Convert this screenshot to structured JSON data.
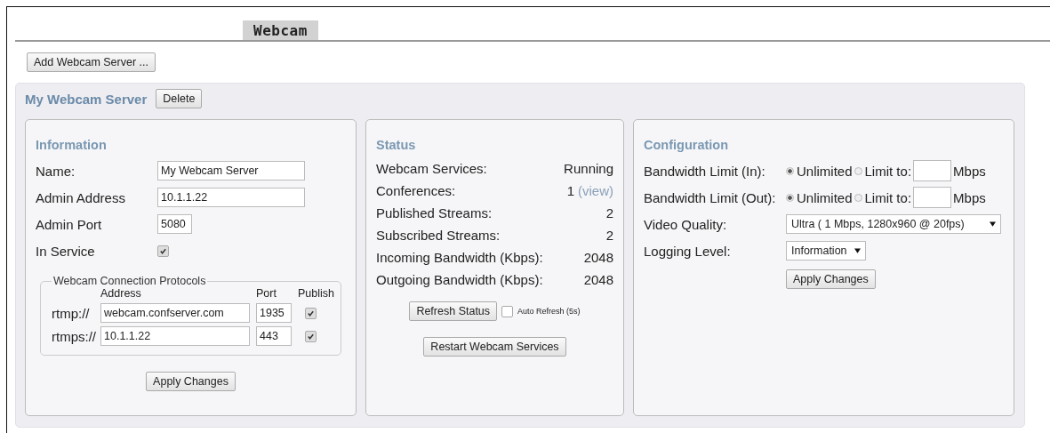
{
  "tabs": [
    {
      "label": "Webcam",
      "selected": true
    }
  ],
  "add_button": "Add Webcam Server ...",
  "server": {
    "name": "My Webcam Server",
    "delete_button": "Delete",
    "information": {
      "title": "Information",
      "fields": [
        {
          "kind": "text",
          "label": "Name:",
          "value": "My Webcam Server"
        },
        {
          "kind": "text",
          "label": "Admin Address",
          "value": "10.1.1.22"
        },
        {
          "kind": "short",
          "label": "Admin Port",
          "value": "5080"
        },
        {
          "kind": "checkbox",
          "label": "In Service",
          "checked": true
        }
      ],
      "protocols": {
        "legend": "Webcam Connection Protocols",
        "columns": [
          "Address",
          "Port",
          "Publish"
        ],
        "rows": [
          {
            "scheme": "rtmp://",
            "address": "webcam.confserver.com",
            "port": "1935",
            "publish": true
          },
          {
            "scheme": "rtmps://",
            "address": "10.1.1.22",
            "port": "443",
            "publish": true
          }
        ]
      },
      "apply_button": "Apply Changes"
    },
    "status": {
      "title": "Status",
      "rows": [
        {
          "label": "Webcam Services:",
          "value": "Running"
        },
        {
          "label": "Conferences:",
          "value": "1",
          "link": "(view)"
        },
        {
          "label": "Published Streams:",
          "value": "2"
        },
        {
          "label": "Subscribed Streams:",
          "value": "2"
        },
        {
          "label": "Incoming Bandwidth (Kbps):",
          "value": "2048"
        },
        {
          "label": "Outgoing Bandwidth (Kbps):",
          "value": "2048"
        }
      ],
      "refresh_button": "Refresh Status",
      "auto_refresh": {
        "label": "Auto Refresh (5s)",
        "checked": false
      },
      "restart_button": "Restart Webcam Services"
    },
    "configuration": {
      "title": "Configuration",
      "bandwidth": [
        {
          "label": "Bandwidth Limit (In):",
          "options": [
            {
              "label": "Unlimited",
              "selected": true
            },
            {
              "label": "Limit to:",
              "selected": false
            }
          ],
          "unit": "Mbps"
        },
        {
          "label": "Bandwidth Limit (Out):",
          "options": [
            {
              "label": "Unlimited",
              "selected": true
            },
            {
              "label": "Limit to:",
              "selected": false
            }
          ],
          "unit": "Mbps"
        }
      ],
      "selects": [
        {
          "kind": "wide",
          "label": "Video Quality:",
          "value": "Ultra ( 1 Mbps, 1280x960 @ 20fps)"
        },
        {
          "kind": "narrow",
          "label": "Logging Level:",
          "value": "Information"
        }
      ],
      "apply_button": "Apply Changes"
    }
  }
}
